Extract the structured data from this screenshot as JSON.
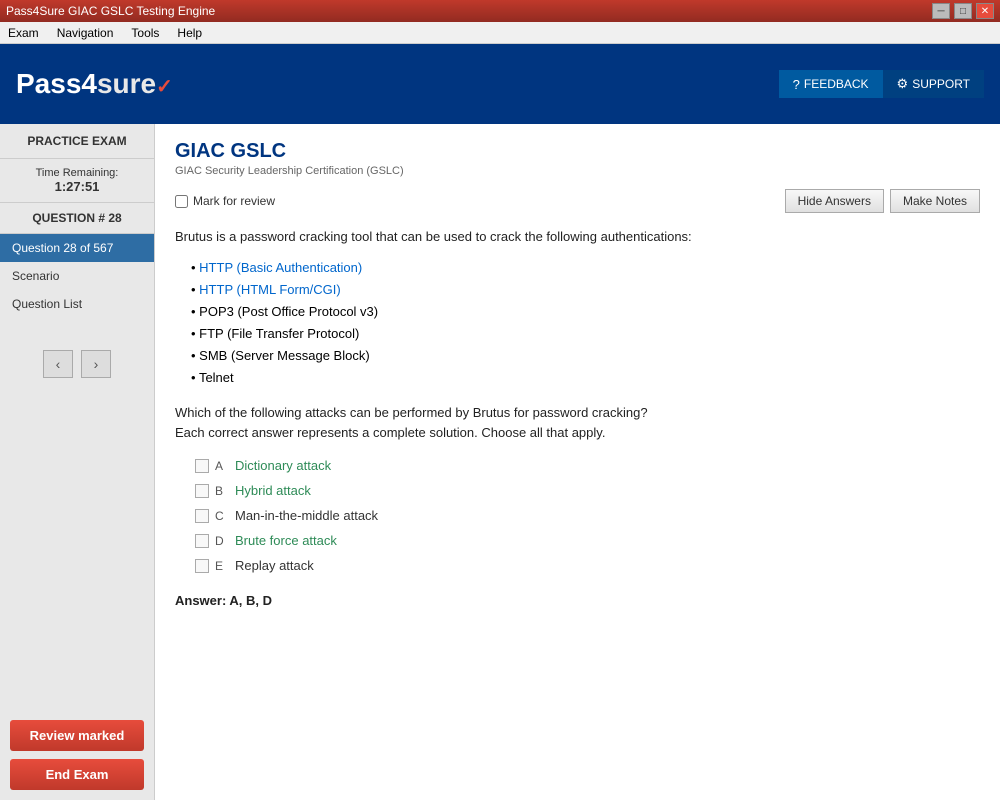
{
  "titlebar": {
    "title": "Pass4Sure GIAC GSLC Testing Engine",
    "controls": [
      "minimize",
      "maximize",
      "close"
    ]
  },
  "menubar": {
    "items": [
      "Exam",
      "Navigation",
      "Tools",
      "Help"
    ]
  },
  "header": {
    "logo": "Pass4Sure",
    "feedback_label": "FEEDBACK",
    "support_label": "SUPPORT"
  },
  "sidebar": {
    "practice_exam_label": "PRACTICE EXAM",
    "time_label": "Time Remaining:",
    "time_value": "1:27:51",
    "question_label": "QUESTION # 28",
    "nav_items": [
      {
        "label": "Question 28 of 567",
        "active": true
      },
      {
        "label": "Scenario",
        "active": false
      },
      {
        "label": "Question List",
        "active": false
      }
    ],
    "prev_arrow": "‹",
    "next_arrow": "›",
    "review_marked_label": "Review marked",
    "end_exam_label": "End Exam"
  },
  "content": {
    "exam_title": "GIAC GSLC",
    "exam_subtitle": "GIAC Security Leadership Certification (GSLC)",
    "mark_review_label": "Mark for review",
    "hide_answers_label": "Hide Answers",
    "make_notes_label": "Make Notes",
    "question_intro": "Brutus is a password cracking tool that can be used to crack the following authentications:",
    "auth_list": [
      "HTTP (Basic Authentication)",
      "HTTP (HTML Form/CGI)",
      "POP3 (Post Office Protocol v3)",
      "FTP (File Transfer Protocol)",
      "SMB (Server Message Block)",
      "Telnet"
    ],
    "sub_question": "Which of the following attacks can be performed by Brutus for password cracking?\nEach correct answer represents a complete solution. Choose all that apply.",
    "options": [
      {
        "letter": "A",
        "text": "Dictionary attack",
        "correct": true
      },
      {
        "letter": "B",
        "text": "Hybrid attack",
        "correct": true
      },
      {
        "letter": "C",
        "text": "Man-in-the-middle attack",
        "correct": false
      },
      {
        "letter": "D",
        "text": "Brute force attack",
        "correct": true
      },
      {
        "letter": "E",
        "text": "Replay attack",
        "correct": false
      }
    ],
    "answer_label": "Answer: A, B, D"
  }
}
